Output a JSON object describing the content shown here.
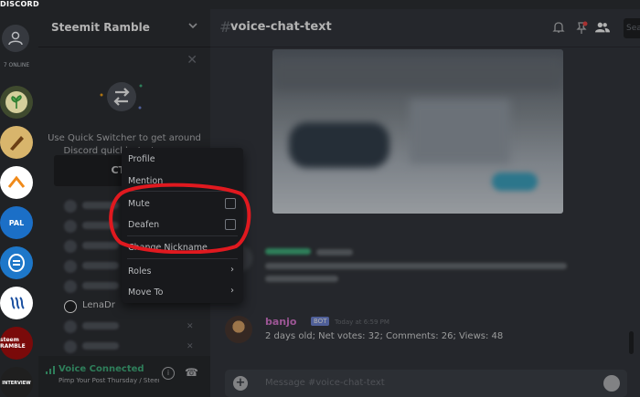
{
  "app": {
    "wordmark": "DISCORD"
  },
  "rail": {
    "online": "7 ONLINE",
    "guilds": [
      "Steemit Ramble",
      "",
      "",
      "PAL",
      "",
      "",
      "steem RAMBLE",
      "INTERVIEW",
      ""
    ]
  },
  "sidebar": {
    "server_name": "Steemit Ramble",
    "quick_switcher": {
      "text_line1": "Use Quick Switcher to get around",
      "text_line2": "Discord quickly. Just press:",
      "button": "CTRL"
    },
    "member_visible": "LenaDr",
    "voice": {
      "status": "Voice Connected",
      "channel": "Pimp Your Post Thursday / Steem..."
    }
  },
  "main": {
    "channel": "voice-chat-text",
    "search_placeholder": "Sea",
    "message": {
      "author": "banjo",
      "badge": "BOT",
      "timestamp": "Today at 6:59 PM",
      "text": "2 days old; Net votes: 32; Comments: 26; Views: 48"
    },
    "composer_placeholder": "Message #voice-chat-text"
  },
  "context_menu": {
    "items": [
      "Profile",
      "Mention",
      "Mute",
      "Deafen",
      "Change Nickname",
      "Roles",
      "Move To"
    ]
  },
  "colors": {
    "accent": "#7289da",
    "voice_green": "#43b581",
    "highlight": "#e0191f"
  }
}
